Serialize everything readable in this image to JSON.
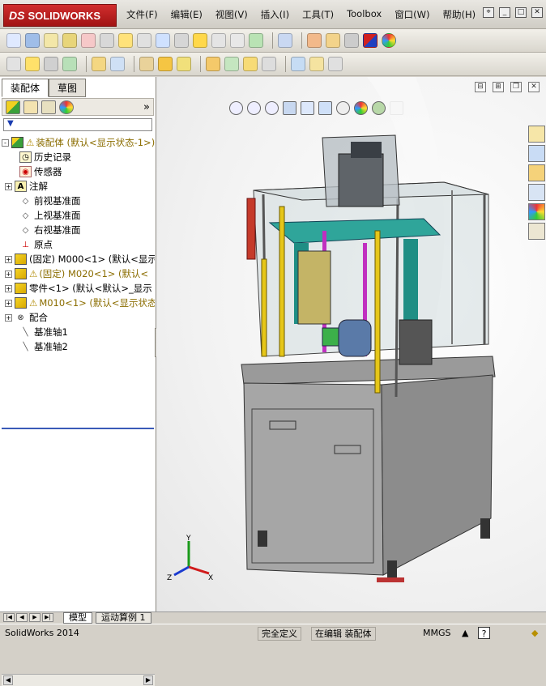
{
  "app": {
    "logo_prefix": "DS",
    "logo_text": "SOLIDWORKS"
  },
  "menu": [
    {
      "label": "文件(F)"
    },
    {
      "label": "编辑(E)"
    },
    {
      "label": "视图(V)"
    },
    {
      "label": "插入(I)"
    },
    {
      "label": "工具(T)"
    },
    {
      "label": "Toolbox"
    },
    {
      "label": "窗口(W)"
    },
    {
      "label": "帮助(H)"
    }
  ],
  "panel_tabs": [
    {
      "label": "装配体"
    },
    {
      "label": "草图"
    }
  ],
  "panel_more": "»",
  "filter_icon": "▼",
  "tree": [
    {
      "label": "装配体  (默认<显示状态-1>)",
      "icon": "assembly-icon",
      "expand": "-",
      "warn": true,
      "color": "yellow"
    },
    {
      "label": "历史记录",
      "icon": "history-icon",
      "expand": ""
    },
    {
      "label": "传感器",
      "icon": "sensor-icon",
      "expand": ""
    },
    {
      "label": "注解",
      "icon": "annotation-icon",
      "expand": "+"
    },
    {
      "label": "前视基准面",
      "icon": "plane-icon",
      "expand": ""
    },
    {
      "label": "上视基准面",
      "icon": "plane-icon",
      "expand": ""
    },
    {
      "label": "右视基准面",
      "icon": "plane-icon",
      "expand": ""
    },
    {
      "label": "原点",
      "icon": "origin-icon",
      "expand": ""
    },
    {
      "label": "(固定) M000<1> (默认<显示",
      "icon": "part-icon",
      "expand": "+"
    },
    {
      "label": "(固定) M020<1> (默认<",
      "icon": "part-icon",
      "expand": "+",
      "warn": true,
      "color": "yellow"
    },
    {
      "label": "零件<1> (默认<默认>_显示",
      "icon": "part-icon",
      "expand": "+"
    },
    {
      "label": "M010<1> (默认<显示状态",
      "icon": "part-icon",
      "expand": "+",
      "warn": true,
      "color": "yellow"
    },
    {
      "label": "配合",
      "icon": "mate-icon",
      "expand": "+"
    },
    {
      "label": "基准轴1",
      "icon": "axis-icon",
      "expand": ""
    },
    {
      "label": "基准轴2",
      "icon": "axis-icon",
      "expand": ""
    }
  ],
  "bottom_tabs": [
    {
      "label": "模型"
    },
    {
      "label": "运动算例 1"
    }
  ],
  "status": {
    "app_version": "SolidWorks 2014",
    "defined": "完全定义",
    "editing": "在编辑 装配体",
    "units": "MMGS"
  },
  "triad": {
    "x": "X",
    "y": "Y",
    "z": "Z"
  },
  "colors": {
    "accent_blue": "#3a5ab8",
    "logo_red": "#c02020",
    "frame_teal": "#2fa59a",
    "frame_yellow": "#e6c619",
    "frame_magenta": "#c030c0"
  }
}
